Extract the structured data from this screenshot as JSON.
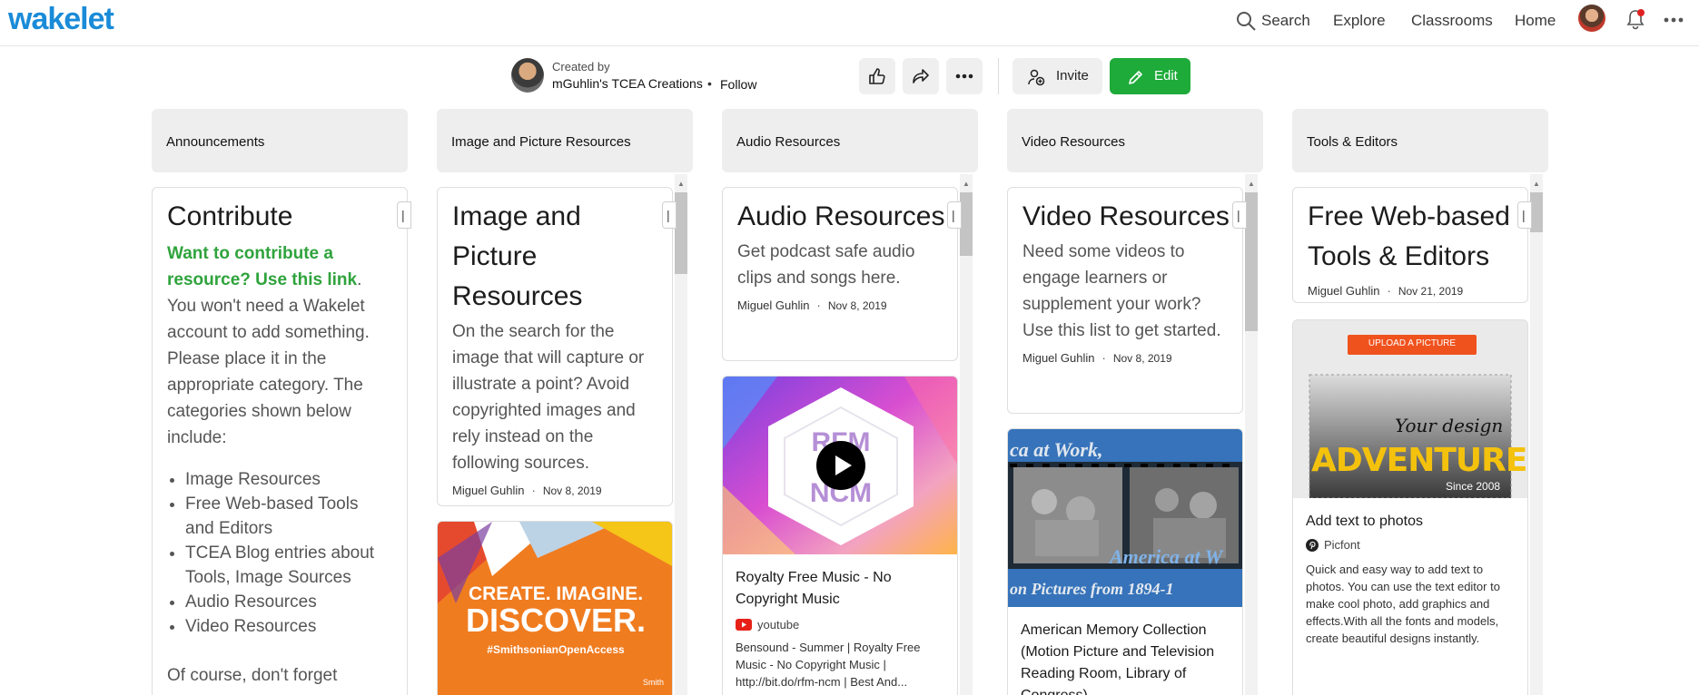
{
  "nav": {
    "logo": "wakelet",
    "search": "Search",
    "explore": "Explore",
    "classrooms": "Classrooms",
    "home": "Home"
  },
  "header": {
    "created_by": "Created by",
    "creator": "mGuhlin's TCEA Creations",
    "dot": "•",
    "follow": "Follow",
    "invite": "Invite",
    "edit": "Edit",
    "edit_color": "#1eab3a"
  },
  "columns": [
    {
      "title": "Announcements"
    },
    {
      "title": "Image and Picture Resources"
    },
    {
      "title": "Audio Resources"
    },
    {
      "title": "Video Resources"
    },
    {
      "title": "Tools & Editors"
    }
  ],
  "cards": {
    "contribute": {
      "title": "Contribute",
      "link_text": "Want to contribute a resource? Use this link",
      "link_period": ".",
      "body": "You won't need a Wakelet account to add something. Please place it in the appropriate category. The categories shown below include:",
      "items": [
        "Image Resources",
        "Free Web-based Tools and Editors",
        "TCEA Blog entries about Tools, Image Sources",
        "Audio Resources",
        "Video Resources"
      ],
      "footer": "Of course, don't forget"
    },
    "image": {
      "title": "Image and Picture Resources",
      "desc": "On the search for the image that will capture or illustrate a point? Avoid copyrighted images and rely instead on the following sources.",
      "author": "Miguel Guhlin",
      "date": "Nov 8, 2019",
      "thumb_line1": "CREATE. IMAGINE.",
      "thumb_line2": "DISCOVER.",
      "thumb_tag": "#SmithsonianOpenAccess",
      "thumb_brand": "Smith"
    },
    "audio": {
      "title": "Audio Resources",
      "desc": "Get podcast safe audio clips and songs here.",
      "author": "Miguel Guhlin",
      "date": "Nov 8, 2019",
      "link_title": "Royalty Free Music - No Copyright Music",
      "source": "youtube",
      "link_desc": "Bensound - Summer | Royalty Free Music - No Copyright Music | http://bit.do/rfm-ncm | Best And...",
      "thumb_top": "RFM",
      "thumb_bottom": "NCM"
    },
    "video": {
      "title": "Video Resources",
      "desc": "Need some videos to engage learners or supplement your work? Use this list to get started.",
      "author": "Miguel Guhlin",
      "date": "Nov 8, 2019",
      "link_title": "American Memory Collection (Motion Picture and Television Reading Room, Library of Congress)",
      "thumb_text_top": "ca at Work,",
      "thumb_text_mid": "America at W",
      "thumb_text_bottom": "on Pictures from 1894-1"
    },
    "tools": {
      "title": "Free Web-based Tools & Editors",
      "author": "Miguel Guhlin",
      "date": "Nov 21, 2019",
      "thumb_button": "UPLOAD A PICTURE",
      "thumb_script": "Your design",
      "thumb_big": "ADVENTURE",
      "thumb_small": "Since 2008",
      "link_title": "Add text to photos",
      "source": "Picfont",
      "link_desc": "Quick and easy way to add text to photos. You can use the text editor to make cool photo, add graphics and effects.With all the fonts and models, create beautiful designs instantly."
    }
  },
  "icons": [
    "search-icon",
    "bell-icon",
    "kebab-icon",
    "thumbs-up-icon",
    "share-icon",
    "more-icon",
    "invite-icon",
    "pencil-icon",
    "play-icon",
    "youtube-icon",
    "pinterest-icon"
  ]
}
